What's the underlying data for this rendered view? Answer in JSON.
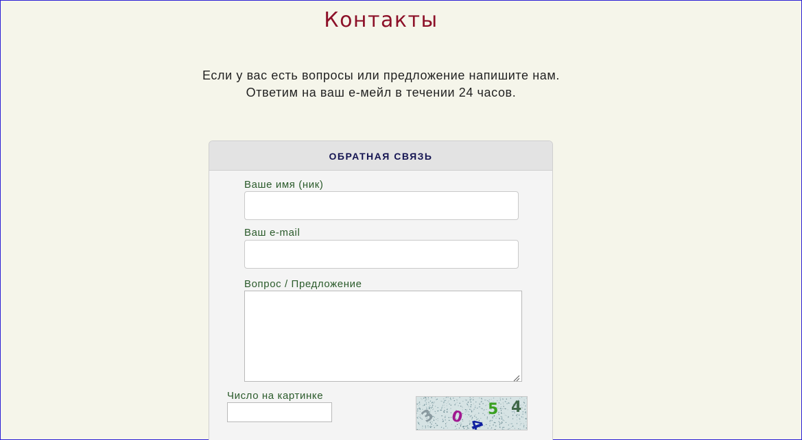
{
  "page": {
    "title": "Контакты",
    "intro_line1": "Если у вас есть вопросы или предложение напишите нам.",
    "intro_line2": "Ответим на ваш е-мейл в течении 24 часов."
  },
  "form": {
    "header": "ОБРАТНАЯ СВЯЗЬ",
    "name_label": "Ваше имя (ник)",
    "name_value": "",
    "email_label": "Ваш e-mail",
    "email_value": "",
    "message_label": "Вопрос / Предложение",
    "message_value": "",
    "captcha_label": "Число на картинке",
    "captcha_value": "",
    "captcha_digits": [
      "3",
      "0",
      "4",
      "5",
      "4"
    ]
  },
  "colors": {
    "background": "#f5f5ea",
    "title": "#8c1028",
    "label": "#2a5a2a",
    "header_text": "#141452",
    "captcha_digit_colors": [
      "#8a9aa0",
      "#a01890",
      "#1020a0",
      "#3aa020",
      "#406848"
    ]
  },
  "icons": {
    "textarea_resize": "resize-grip-icon"
  }
}
